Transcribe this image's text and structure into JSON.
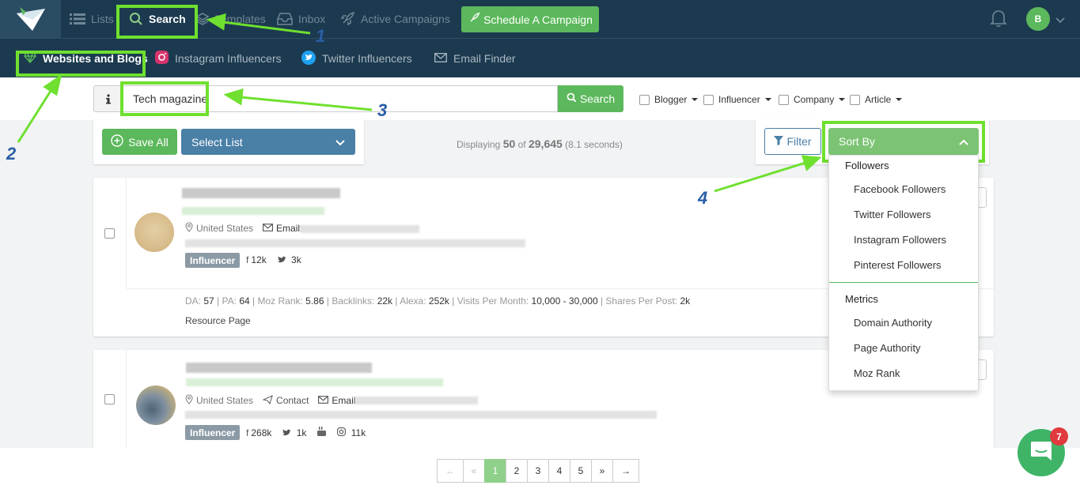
{
  "nav": {
    "items": [
      {
        "label": "Lists",
        "icon": "list-icon"
      },
      {
        "label": "Search",
        "icon": "search-icon"
      },
      {
        "label": "Templates",
        "icon": "layers-icon"
      },
      {
        "label": "Inbox",
        "icon": "inbox-icon"
      },
      {
        "label": "Active Campaigns",
        "icon": "rocket-icon"
      }
    ],
    "schedule_label": "Schedule A Campaign",
    "avatar_initial": "B"
  },
  "subnav": {
    "items": [
      {
        "label": "Websites and Blogs",
        "icon": "gem-icon"
      },
      {
        "label": "Instagram Influencers",
        "icon": "instagram-icon"
      },
      {
        "label": "Twitter Influencers",
        "icon": "twitter-icon"
      },
      {
        "label": "Email Finder",
        "icon": "envelope-icon"
      }
    ]
  },
  "search": {
    "value": "Tech magazine",
    "button_label": "Search",
    "filters": [
      "Blogger",
      "Influencer",
      "Company",
      "Article"
    ]
  },
  "actions": {
    "save_all_label": "Save All",
    "select_list_label": "Select List"
  },
  "results_summary": {
    "prefix": "Displaying",
    "shown": "50",
    "of": "of",
    "total": "29,645",
    "time": "(8.1 seconds)"
  },
  "sort": {
    "filter_label": "Filter",
    "sort_label": "Sort By",
    "groups": [
      {
        "header": "Followers",
        "items": [
          "Facebook Followers",
          "Twitter Followers",
          "Instagram Followers",
          "Pinterest Followers"
        ]
      },
      {
        "header": "Metrics",
        "items": [
          "Domain Authority",
          "Page Authority",
          "Moz Rank"
        ]
      }
    ]
  },
  "results": [
    {
      "location": "United States",
      "email_label": "Email:",
      "badge": "Influencer",
      "facebook": "12k",
      "twitter": "3k",
      "stats": [
        {
          "label": "DA:",
          "value": "57"
        },
        {
          "label": "PA:",
          "value": "64"
        },
        {
          "label": "Moz Rank:",
          "value": "5.86"
        },
        {
          "label": "Backlinks:",
          "value": "22k"
        },
        {
          "label": "Alexa:",
          "value": "252k"
        },
        {
          "label": "Visits Per Month:",
          "value": "10,000 - 30,000"
        },
        {
          "label": "Shares Per Post:",
          "value": "2k"
        }
      ],
      "category": "Resource Page"
    },
    {
      "location": "United States",
      "contact_label": "Contact",
      "email_label": "Email:",
      "badge": "Influencer",
      "facebook": "268k",
      "twitter": "1k",
      "instagram": "11k"
    }
  ],
  "pagination": {
    "first": "←",
    "prev": "«",
    "pages": [
      "1",
      "2",
      "3",
      "4",
      "5"
    ],
    "next": "»",
    "last": "→",
    "current": "1"
  },
  "chat": {
    "unread": "7"
  },
  "annotations": [
    "1",
    "2",
    "3",
    "4"
  ],
  "colors": {
    "accent": "#5cb85c",
    "nav_bg": "#1c3a4f",
    "highlight": "#6fe02f",
    "annotation": "#2a5ea6"
  }
}
